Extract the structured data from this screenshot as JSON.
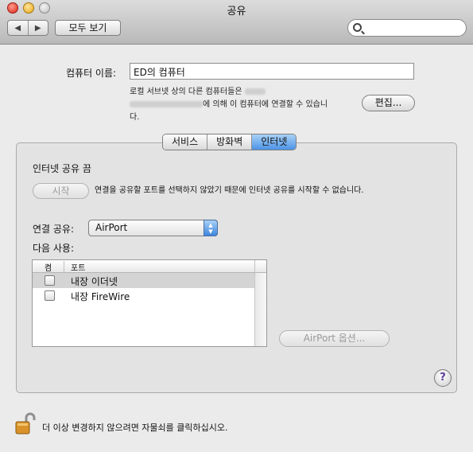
{
  "window": {
    "title": "공유",
    "show_all_label": "모두 보기",
    "search_placeholder": ""
  },
  "computer_name": {
    "label": "컴퓨터 이름:",
    "value": "ED의 컴퓨터",
    "description_line1": "로컬 서브넷 상의 다른 컴퓨터들은",
    "description_line2": "에 의해 이 컴퓨터에 연결할 수 있습니",
    "description_line3": "다.",
    "edit_label": "편집..."
  },
  "tabs": [
    {
      "label": "서비스",
      "active": false
    },
    {
      "label": "방화벽",
      "active": false
    },
    {
      "label": "인터넷",
      "active": true
    }
  ],
  "internet": {
    "status_title": "인터넷 공유 끔",
    "start_label": "시작",
    "start_message": "연결을 공유할 포트를 선택하지 않았기 때문에 인터넷 공유를 시작할 수 없습니다.",
    "share_from_label": "연결 공유:",
    "share_from_value": "AirPort",
    "to_computers_label": "다음 사용:",
    "columns": {
      "on": "켬",
      "port": "포트"
    },
    "ports": [
      {
        "name": "내장 이더넷",
        "checked": false,
        "selected": true
      },
      {
        "name": "내장 FireWire",
        "checked": false,
        "selected": false
      }
    ],
    "airport_options_label": "AirPort 옵션..."
  },
  "help_label": "?",
  "footer": {
    "lock_text": "더 이상 변경하지 않으려면 자물쇠를 클릭하십시오."
  }
}
